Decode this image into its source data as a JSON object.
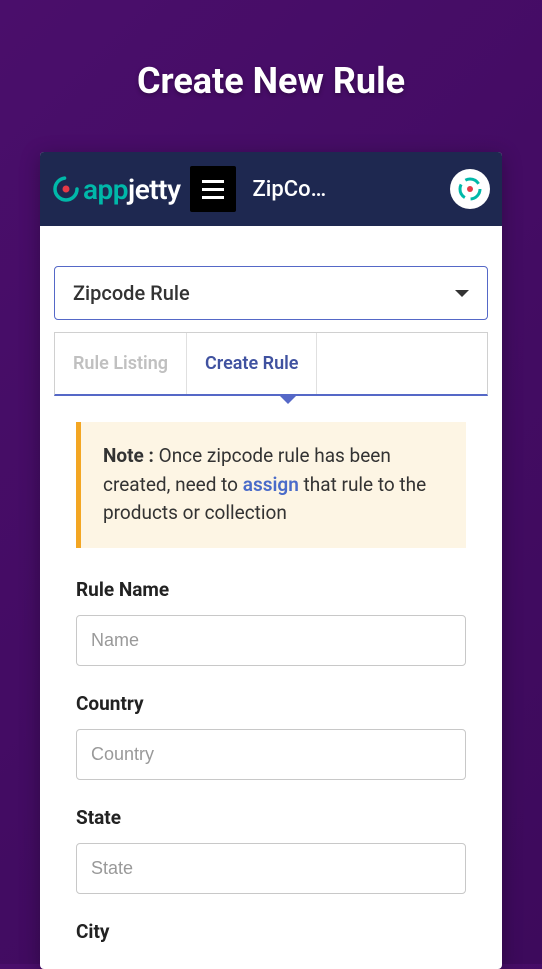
{
  "page": {
    "title": "Create New Rule"
  },
  "topbar": {
    "brand_app": "app",
    "brand_jetty": "jetty",
    "title": "ZipCo…"
  },
  "dropdown": {
    "selected": "Zipcode Rule"
  },
  "tabs": {
    "items": [
      {
        "label": "Rule Listing",
        "active": false
      },
      {
        "label": "Create Rule",
        "active": true
      }
    ]
  },
  "note": {
    "label": "Note :",
    "before": " Once zipcode rule has been created, need to ",
    "link": "assign",
    "after": " that rule to the products or collection"
  },
  "form": {
    "rule_name": {
      "label": "Rule Name",
      "placeholder": "Name"
    },
    "country": {
      "label": "Country",
      "placeholder": "Country"
    },
    "state": {
      "label": "State",
      "placeholder": "State"
    },
    "city": {
      "label": "City"
    }
  }
}
